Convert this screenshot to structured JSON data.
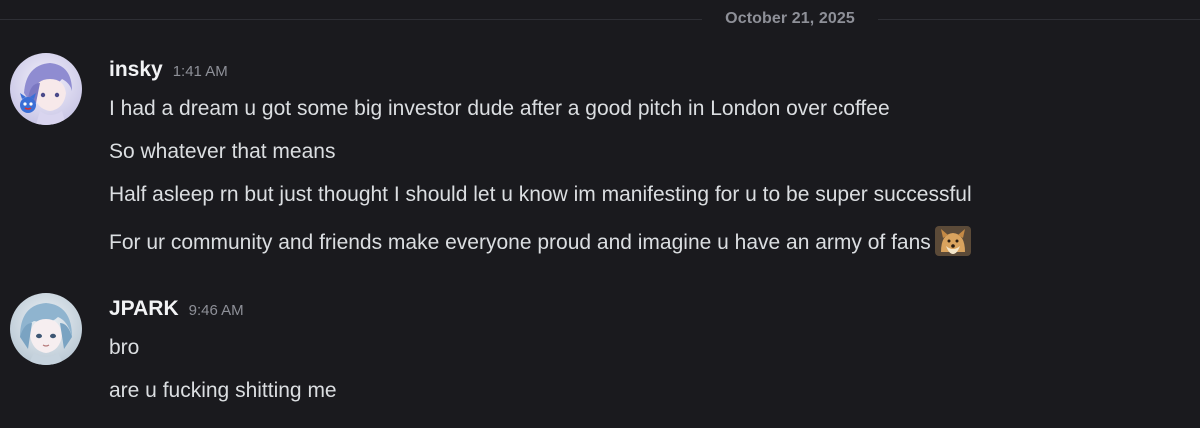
{
  "date_divider": "October 21, 2025",
  "messages": [
    {
      "username": "insky",
      "timestamp": "1:41 AM",
      "lines": [
        "I had a dream u got some big investor dude after a good pitch in London over coffee",
        "So whatever that means",
        "Half asleep rn but just thought I should let u know im manifesting for u to be super successful",
        "For ur community and friends make everyone proud and imagine u have an army of fans"
      ],
      "emoji": "doge-emoji"
    },
    {
      "username": "JPARK",
      "timestamp": "9:46 AM",
      "lines": [
        "bro",
        "are u fucking shitting me"
      ]
    }
  ],
  "colors": {
    "background": "#1a1a1e",
    "username": "#f2f3f5",
    "text": "#dbdee1",
    "muted": "#8e9098"
  }
}
